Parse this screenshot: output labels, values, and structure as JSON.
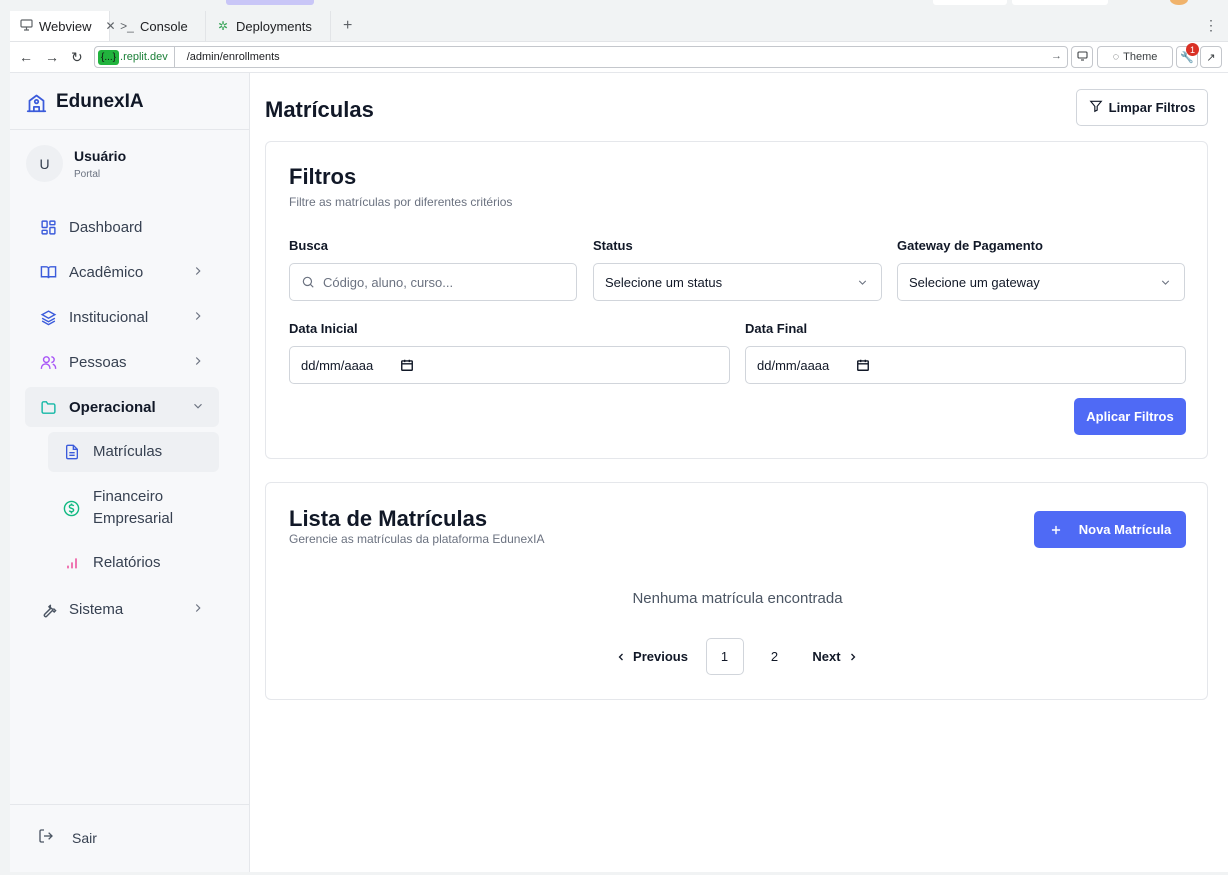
{
  "browser": {
    "tabs": [
      {
        "label": "Webview",
        "icon": "monitor-icon",
        "active": true
      },
      {
        "label": "Console",
        "icon": "terminal-icon",
        "active": false
      },
      {
        "label": "Deployments",
        "icon": "deployments-icon",
        "active": false
      }
    ],
    "new_tab_label": "+",
    "url_badge": "{...}",
    "url_host": ".replit.dev",
    "url_path": "/admin/enrollments",
    "theme_label": "Theme",
    "notification_count": "1"
  },
  "sidebar": {
    "brand": "EdunexIA",
    "user": {
      "initial": "U",
      "name": "Usuário",
      "role": "Portal"
    },
    "items": [
      {
        "label": "Dashboard",
        "icon": "dashboard-icon"
      },
      {
        "label": "Acadêmico",
        "icon": "book-icon"
      },
      {
        "label": "Institucional",
        "icon": "layers-icon"
      },
      {
        "label": "Pessoas",
        "icon": "users-icon"
      },
      {
        "label": "Operacional",
        "icon": "folder-icon"
      },
      {
        "label": "Sistema",
        "icon": "wrench-icon"
      }
    ],
    "subitems": [
      {
        "label": "Matrículas",
        "icon": "file-icon"
      },
      {
        "label": "Financeiro Empresarial",
        "icon": "dollar-icon"
      },
      {
        "label": "Relatórios",
        "icon": "bar-chart-icon"
      }
    ],
    "logout": "Sair"
  },
  "main": {
    "title": "Matrículas",
    "clear_filters": "Limpar Filtros",
    "filters": {
      "title": "Filtros",
      "subtitle": "Filtre as matrículas por diferentes critérios",
      "search_label": "Busca",
      "search_placeholder": "Código, aluno, curso...",
      "status_label": "Status",
      "status_value": "Selecione um status",
      "gateway_label": "Gateway de Pagamento",
      "gateway_value": "Selecione um gateway",
      "start_label": "Data Inicial",
      "start_value": "dd/mm/aaaa",
      "end_label": "Data Final",
      "end_value": "dd/mm/aaaa",
      "apply": "Aplicar Filtros"
    },
    "list": {
      "title": "Lista de Matrículas",
      "subtitle": "Gerencie as matrículas da plataforma EdunexIA",
      "new_button": "Nova Matrícula",
      "empty": "Nenhuma matrícula encontrada",
      "pagination": {
        "previous": "Previous",
        "pages": [
          "1",
          "2"
        ],
        "next": "Next",
        "current": "1"
      }
    }
  },
  "colors": {
    "primary": "#4f6af5",
    "sidebar_bg": "#f7f8fa",
    "active_item_bg": "#eef0f3"
  }
}
